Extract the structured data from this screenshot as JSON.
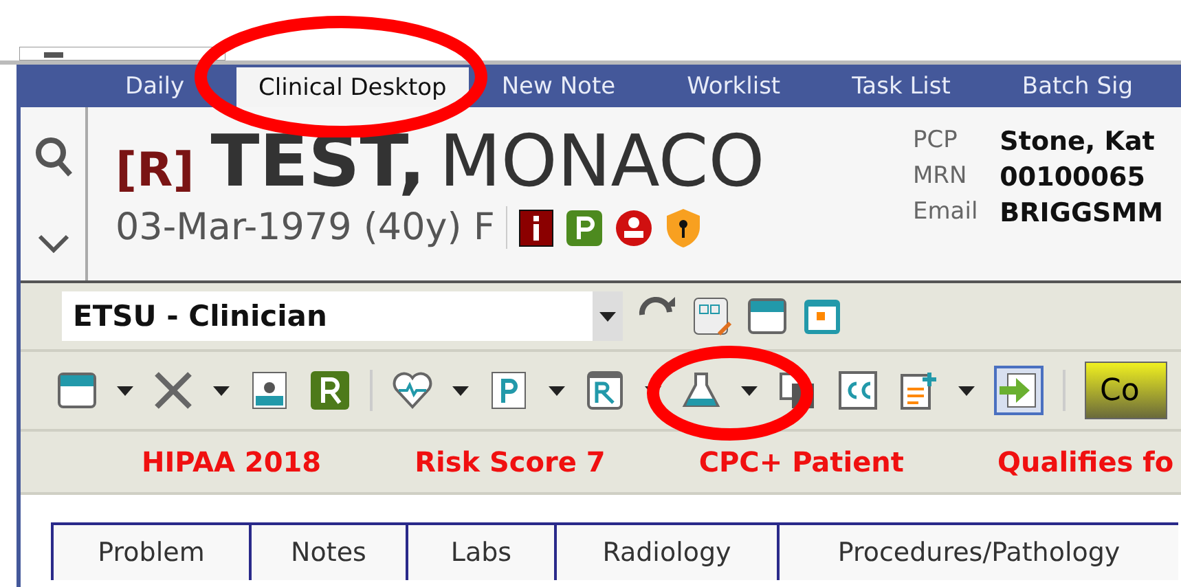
{
  "nav_tabs": [
    {
      "label": "Daily",
      "selected": false
    },
    {
      "label": "Clinical Desktop",
      "selected": true
    },
    {
      "label": "New Note",
      "selected": false
    },
    {
      "label": "Worklist",
      "selected": false
    },
    {
      "label": "Task List",
      "selected": false
    },
    {
      "label": "Batch Sig",
      "selected": false
    }
  ],
  "patient": {
    "flag": "[R]",
    "last_name": "TEST,",
    "first_name": "MONACO",
    "demographics": "03-Mar-1979 (40y) F"
  },
  "details": [
    {
      "label": "PCP",
      "value": "Stone, Kat"
    },
    {
      "label": "MRN",
      "value": "00100065"
    },
    {
      "label": "Email",
      "value": "BRIGGSMM"
    }
  ],
  "profile_select": {
    "value": "ETSU - Clinician"
  },
  "toolbar_button": "Co",
  "alerts": [
    "HIPAA 2018",
    "Risk Score 7",
    "CPC+ Patient",
    "Qualifies fo"
  ],
  "chart_tabs": [
    "Problem",
    "Notes",
    "Labs",
    "Radiology",
    "Procedures/Pathology"
  ]
}
